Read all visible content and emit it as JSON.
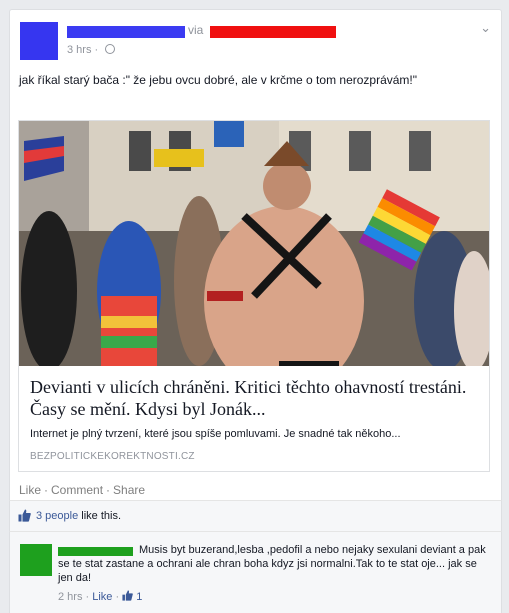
{
  "post": {
    "via": "via",
    "time": "3 hrs",
    "status": "jak říkal starý bača :\" že jebu ovcu dobré, ale v krčme o tom nerozprávám!\""
  },
  "link": {
    "title": "Devianti v ulicích chráněni. Kritici těchto ohavností trestáni. Časy se mění. Kdysi byl Jonák...",
    "description": "Internet je plný tvrzení, které jsou spíše pomluvami. Je snadné tak někoho...",
    "domain": "BEZPOLITICKEKOREKTNOSTI.CZ"
  },
  "actions": {
    "like": "Like",
    "comment": "Comment",
    "share": "Share",
    "sep": "·"
  },
  "likes": {
    "count": "3 people",
    "suffix": "like this."
  },
  "comment": {
    "text": "Musis byt buzerand,lesba ,pedofil a nebo nejaky sexulani deviant a pak se te stat zastane a ochrani ale chran boha kdyz jsi normalni.Tak to te stat oje... jak se jen da!",
    "time": "2 hrs",
    "like": "Like",
    "like_count": "1"
  },
  "colors": {
    "fb_blue": "#3b5998",
    "redact_blue": "#3b3bf2",
    "redact_red": "#f01010",
    "redact_green": "#1ea01e"
  }
}
